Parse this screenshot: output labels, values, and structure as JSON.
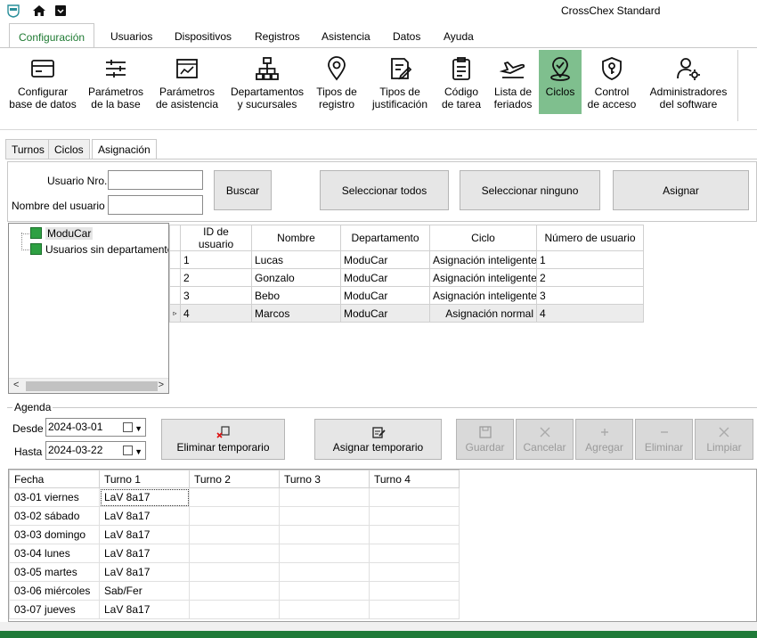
{
  "app": {
    "title": "CrossChex Standard"
  },
  "menu": {
    "tabs": [
      "Configuración",
      "Usuarios",
      "Dispositivos",
      "Registros",
      "Asistencia",
      "Datos",
      "Ayuda"
    ]
  },
  "ribbon": {
    "items": [
      {
        "line1": "Configurar",
        "line2": "base de datos",
        "icon": "database-card-icon"
      },
      {
        "line1": "Parámetros",
        "line2": "de la base",
        "icon": "sliders-icon"
      },
      {
        "line1": "Parámetros",
        "line2": "de asistencia",
        "icon": "chart-frame-icon"
      },
      {
        "line1": "Departamentos",
        "line2": "y sucursales",
        "icon": "org-chart-icon"
      },
      {
        "line1": "Tipos de",
        "line2": "registro",
        "icon": "location-pin-icon"
      },
      {
        "line1": "Tipos de",
        "line2": "justificación",
        "icon": "document-edit-icon"
      },
      {
        "line1": "Código",
        "line2": "de tarea",
        "icon": "clipboard-icon"
      },
      {
        "line1": "Lista de",
        "line2": "feriados",
        "icon": "plane-icon"
      },
      {
        "line1": "Ciclos",
        "line2": "",
        "icon": "cycle-pin-icon"
      },
      {
        "line1": "Control",
        "line2": "de acceso",
        "icon": "shield-key-icon"
      },
      {
        "line1": "Administradores",
        "line2": "del software",
        "icon": "user-gear-icon"
      }
    ]
  },
  "subtabs": [
    "Turnos",
    "Ciclos",
    "Asignación"
  ],
  "search": {
    "user_no_label": "Usuario Nro.",
    "user_name_label": "Nombre del usuario",
    "user_no_value": "",
    "user_name_value": "",
    "search_btn": "Buscar",
    "select_all_btn": "Seleccionar todos",
    "select_none_btn": "Seleccionar ninguno",
    "assign_btn": "Asignar"
  },
  "tree": {
    "items": [
      "ModuCar",
      "Usuarios sin departamento"
    ]
  },
  "users_table": {
    "columns": [
      "ID de usuario",
      "Nombre",
      "Departamento",
      "Ciclo",
      "Número de usuario"
    ],
    "rows": [
      [
        "1",
        "Lucas",
        "ModuCar",
        "Asignación inteligente",
        "1"
      ],
      [
        "2",
        "Gonzalo",
        "ModuCar",
        "Asignación inteligente",
        "2"
      ],
      [
        "3",
        "Bebo",
        "ModuCar",
        "Asignación inteligente",
        "3"
      ],
      [
        "4",
        "Marcos",
        "ModuCar",
        "Asignación normal",
        "4"
      ]
    ],
    "row_marker": "▹"
  },
  "agenda": {
    "title": "Agenda",
    "from_label": "Desde",
    "to_label": "Hasta",
    "from_value": "2024-03-01",
    "to_value": "2024-03-22",
    "delete_temp_btn": "Eliminar temporario",
    "assign_temp_btn": "Asignar temporario",
    "save_btn": "Guardar",
    "cancel_btn": "Cancelar",
    "add_btn": "Agregar",
    "delete_btn": "Eliminar",
    "clear_btn": "Limpiar"
  },
  "schedule": {
    "columns": [
      "Fecha",
      "Turno 1",
      "Turno 2",
      "Turno 3",
      "Turno 4"
    ],
    "rows": [
      [
        "03-01 viernes",
        "LaV 8a17",
        "",
        "",
        ""
      ],
      [
        "03-02 sábado",
        "LaV 8a17",
        "",
        "",
        ""
      ],
      [
        "03-03 domingo",
        "LaV 8a17",
        "",
        "",
        ""
      ],
      [
        "03-04 lunes",
        "LaV 8a17",
        "",
        "",
        ""
      ],
      [
        "03-05 martes",
        "LaV 8a17",
        "",
        "",
        ""
      ],
      [
        "03-06 miércoles",
        "Sab/Fer",
        "",
        "",
        ""
      ],
      [
        "03-07 jueves",
        "LaV 8a17",
        "",
        "",
        ""
      ]
    ]
  },
  "colors": {
    "accent": "#1e7a32",
    "active_ribbon": "#7fbf8e",
    "statusbar": "#1f7a38"
  }
}
